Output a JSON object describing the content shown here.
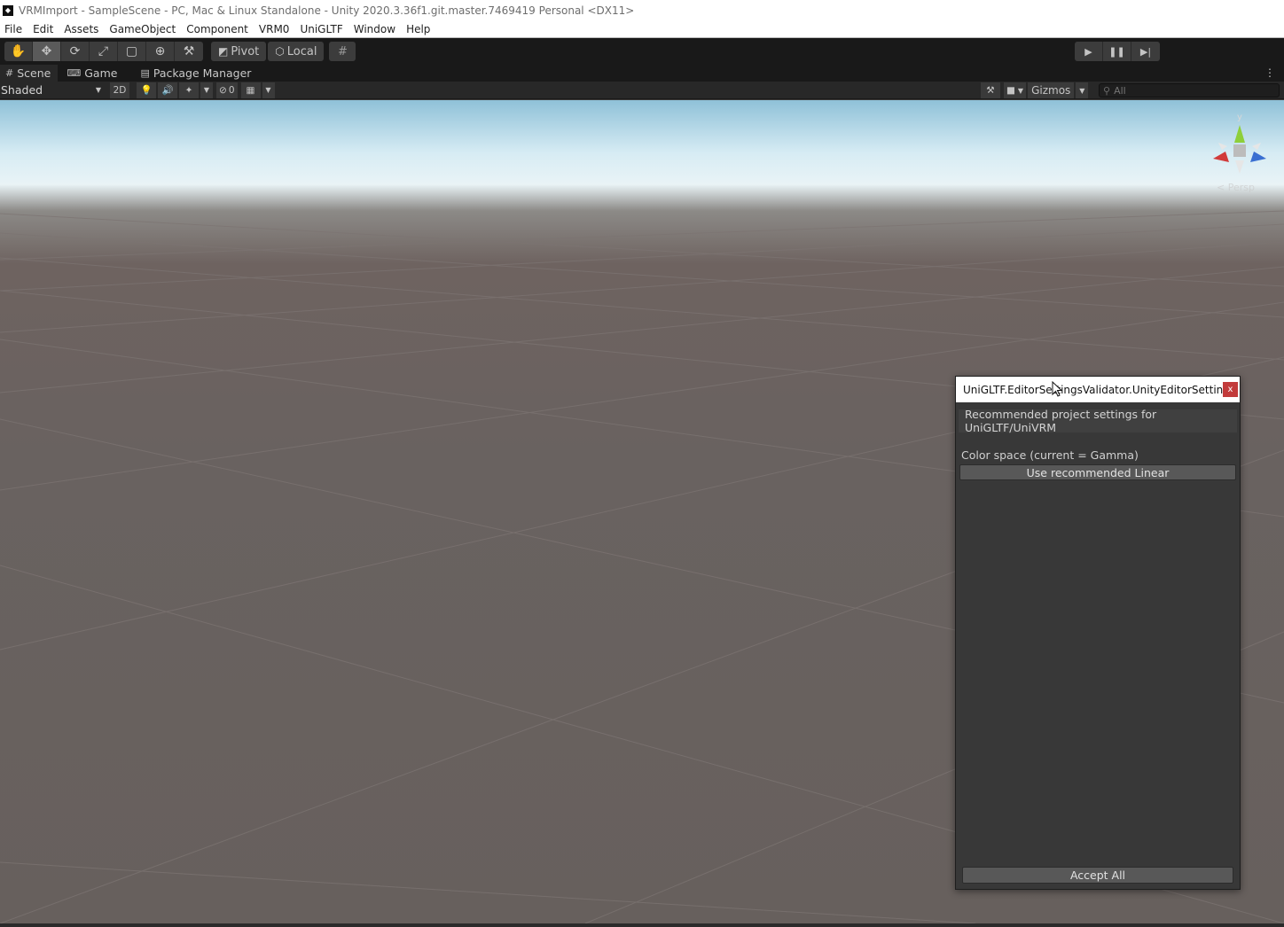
{
  "window": {
    "title": "VRMImport - SampleScene - PC, Mac & Linux Standalone - Unity 2020.3.36f1.git.master.7469419 Personal <DX11>"
  },
  "menu": {
    "items": [
      "File",
      "Edit",
      "Assets",
      "GameObject",
      "Component",
      "VRM0",
      "UniGLTF",
      "Window",
      "Help"
    ]
  },
  "toolbar": {
    "pivot_label": "Pivot",
    "local_label": "Local"
  },
  "tabs": {
    "items": [
      "Scene",
      "Game",
      "Package Manager"
    ],
    "active": "Scene"
  },
  "scene_toolbar": {
    "draw_mode": "Shaded",
    "mode_2d": "2D",
    "hidden_count": "0",
    "gizmos_label": "Gizmos",
    "search_placeholder": "All"
  },
  "validator": {
    "title": "UniGLTF.EditorSettingsValidator.UnityEditorSettingsVa...",
    "close_label": "x",
    "heading": "Recommended project settings for UniGLTF/UniVRM",
    "color_space_label": "Color space (current = Gamma)",
    "use_linear_button": "Use recommended Linear",
    "accept_all_button": "Accept All"
  },
  "gizmo": {
    "axis_y_label": "y",
    "projection_label": "< Persp"
  },
  "colors": {
    "toolbar_bg": "#191919",
    "scene_toolbar_bg": "#282828",
    "panel_bg": "#383838",
    "close_red": "#c23b3b",
    "axis_x": "#d13a3a",
    "axis_y": "#8ecf3a",
    "axis_z": "#3a6fd1"
  }
}
